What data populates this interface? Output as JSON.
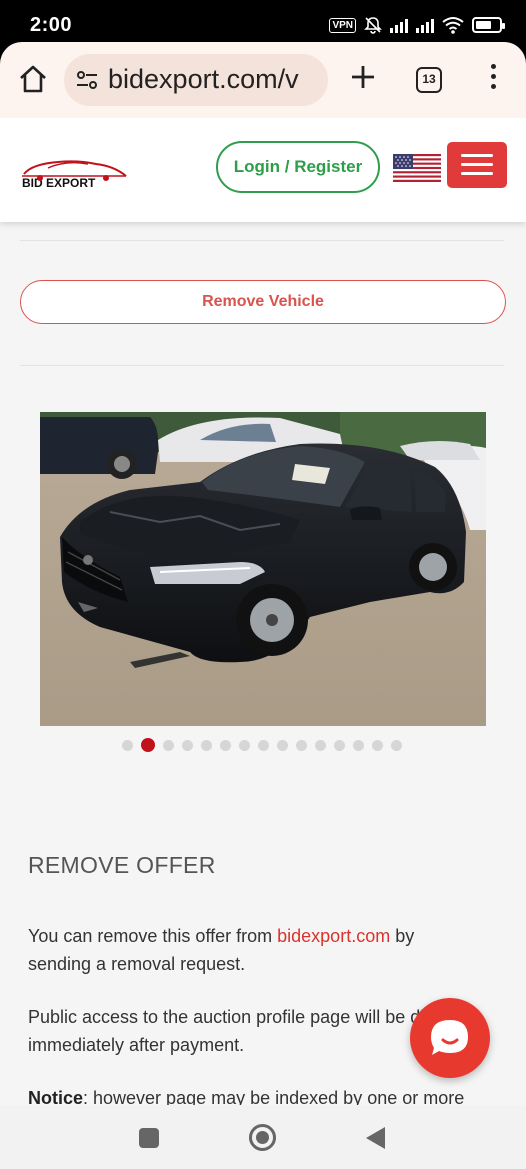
{
  "status_bar": {
    "time": "2:00",
    "vpn_label": "VPN",
    "battery_percent": 70
  },
  "browser": {
    "url": "bidexport.com/v",
    "tab_count": "13"
  },
  "header": {
    "logo_text": "BID EXPORT",
    "login_label": "Login / Register",
    "flag": "us-flag-icon",
    "menu_icon": "hamburger-icon"
  },
  "main": {
    "remove_vehicle_label": "Remove Vehicle",
    "carousel": {
      "total_images": 15,
      "active_index": 1
    },
    "remove_offer": {
      "title": "REMOVE OFFER",
      "p1_before": "You can remove this offer from ",
      "p1_link": "bidexport.com",
      "p1_after": " by sending a removal request.",
      "p2": "Public access to the auction profile page will be disabled immediately after payment.",
      "p3_bold": "Notice",
      "p3_rest": ": however page may be indexed by one or more"
    }
  },
  "colors": {
    "accent_red": "#e03a3a",
    "login_green": "#2e9e4a",
    "link_red": "#d9342b"
  }
}
